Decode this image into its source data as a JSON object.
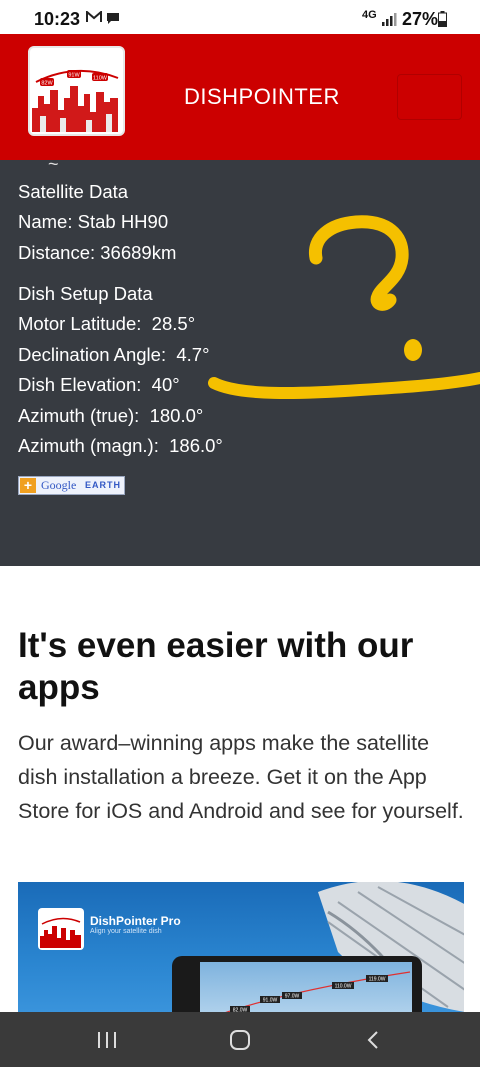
{
  "status_bar": {
    "time": "10:23",
    "network": "4G",
    "battery": "27%"
  },
  "header": {
    "brand": "DISHPOINTER",
    "logo_labels": [
      "82W",
      "91W",
      "110W"
    ]
  },
  "satellite_data": {
    "heading": "Satellite Data",
    "name": "Name: Stab HH90",
    "distance": "Distance: 36689km"
  },
  "dish_setup": {
    "heading": "Dish Setup Data",
    "motor_latitude": "Motor Latitude:  28.5°",
    "declination_angle": "Declination Angle:  4.7°",
    "dish_elevation": "Dish Elevation:  40°",
    "azimuth_true": "Azimuth (true):  180.0°",
    "azimuth_magn": "Azimuth (magn.):  186.0°"
  },
  "google_earth_button": {
    "google": "Google",
    "earth": "EARTH"
  },
  "apps": {
    "heading": "It's even easier with our apps",
    "text": "Our award–winning apps make the satellite dish installation a breeze. Get it on the App Store for iOS and Android and see for yourself.",
    "promo_title": "DishPointer Pro",
    "promo_subtitle": "Align your satellite dish",
    "promo_badges": [
      "82.0W",
      "91.0W",
      "97.0W",
      "110.0W",
      "119.0W"
    ]
  },
  "colors": {
    "header_red": "#cc0000",
    "panel_dark": "#373b41",
    "scribble_yellow": "#f5c000"
  }
}
